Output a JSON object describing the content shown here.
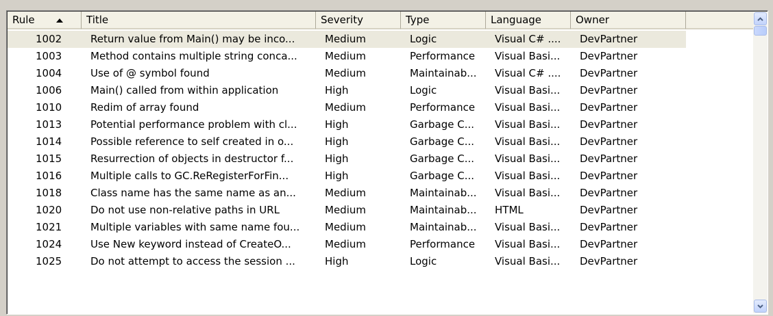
{
  "table": {
    "columns": [
      "Rule",
      "Title",
      "Severity",
      "Type",
      "Language",
      "Owner",
      ""
    ],
    "sorted_column": "Rule",
    "sort_direction": "ascending",
    "selected_row": 0,
    "rows": [
      {
        "rule": "1002",
        "title": "Return value from Main() may be inco...",
        "severity": "Medium",
        "type": "Logic",
        "language": "Visual C# ....",
        "owner": "DevPartner"
      },
      {
        "rule": "1003",
        "title": "Method contains multiple string conca...",
        "severity": "Medium",
        "type": "Performance",
        "language": "Visual Basi...",
        "owner": "DevPartner"
      },
      {
        "rule": "1004",
        "title": "Use of @ symbol found",
        "severity": "Medium",
        "type": "Maintainab...",
        "language": "Visual C# ....",
        "owner": "DevPartner"
      },
      {
        "rule": "1006",
        "title": "Main() called from within application",
        "severity": "High",
        "type": "Logic",
        "language": "Visual Basi...",
        "owner": "DevPartner"
      },
      {
        "rule": "1010",
        "title": "Redim of array found",
        "severity": "Medium",
        "type": "Performance",
        "language": "Visual Basi...",
        "owner": "DevPartner"
      },
      {
        "rule": "1013",
        "title": "Potential performance problem with cl...",
        "severity": "High",
        "type": "Garbage C...",
        "language": "Visual Basi...",
        "owner": "DevPartner"
      },
      {
        "rule": "1014",
        "title": "Possible reference to self created in o...",
        "severity": "High",
        "type": "Garbage C...",
        "language": "Visual Basi...",
        "owner": "DevPartner"
      },
      {
        "rule": "1015",
        "title": "Resurrection of objects in destructor f...",
        "severity": "High",
        "type": "Garbage C...",
        "language": "Visual Basi...",
        "owner": "DevPartner"
      },
      {
        "rule": "1016",
        "title": "Multiple calls to GC.ReRegisterForFin...",
        "severity": "High",
        "type": "Garbage C...",
        "language": "Visual Basi...",
        "owner": "DevPartner"
      },
      {
        "rule": "1018",
        "title": "Class name has the same name as an...",
        "severity": "Medium",
        "type": "Maintainab...",
        "language": "Visual Basi...",
        "owner": "DevPartner"
      },
      {
        "rule": "1020",
        "title": "Do not use non-relative paths in URL",
        "severity": "Medium",
        "type": "Maintainab...",
        "language": "HTML",
        "owner": "DevPartner"
      },
      {
        "rule": "1021",
        "title": "Multiple variables with same name fou...",
        "severity": "Medium",
        "type": "Maintainab...",
        "language": "Visual Basi...",
        "owner": "DevPartner"
      },
      {
        "rule": "1024",
        "title": "Use New keyword instead of CreateO...",
        "severity": "Medium",
        "type": "Performance",
        "language": "Visual Basi...",
        "owner": "DevPartner"
      },
      {
        "rule": "1025",
        "title": "Do not attempt to access the session ...",
        "severity": "High",
        "type": "Logic",
        "language": "Visual Basi...",
        "owner": "DevPartner"
      }
    ]
  },
  "scrollbar": {
    "position": 0
  },
  "colors": {
    "window_bg": "#d4d0c8",
    "header_bg": "#f3f1e6",
    "selected_row": "#ebe9dd",
    "scroll_button": "#c2d3fb"
  },
  "icons": {
    "sort": "sort-ascending-icon",
    "scroll_up": "arrow-up-icon",
    "scroll_down": "arrow-down-icon"
  }
}
